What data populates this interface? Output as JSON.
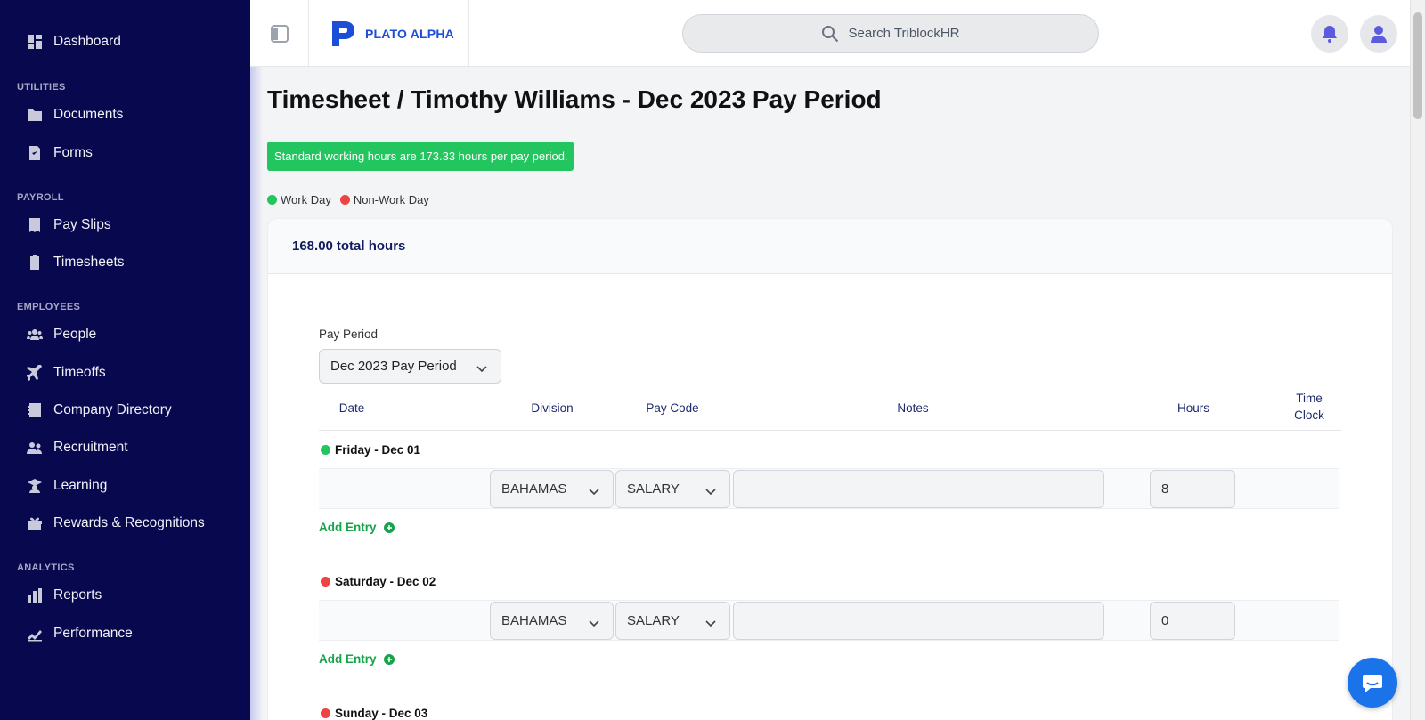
{
  "sidebar": {
    "dashboard": "Dashboard",
    "sections": {
      "utilities": "UTILITIES",
      "payroll": "PAYROLL",
      "employees": "EMPLOYEES",
      "analytics": "ANALYTICS"
    },
    "items": {
      "documents": "Documents",
      "forms": "Forms",
      "pay_slips": "Pay Slips",
      "timesheets": "Timesheets",
      "people": "People",
      "timeoffs": "Timeoffs",
      "company_directory": "Company Directory",
      "recruitment": "Recruitment",
      "learning": "Learning",
      "rewards": "Rewards & Recognitions",
      "reports": "Reports",
      "performance": "Performance"
    }
  },
  "header": {
    "logo_text": "PLATO ALPHA",
    "search_placeholder": "Search TriblockHR"
  },
  "page": {
    "title": "Timesheet / Timothy Williams - Dec 2023 Pay Period",
    "banner": "Standard working hours are 173.33 hours per pay period.",
    "legend": {
      "work_day": "Work Day",
      "non_work_day": "Non-Work Day"
    },
    "total_hours_value": "168.00",
    "total_hours_label": "total hours",
    "pay_period_label": "Pay Period",
    "pay_period_value": "Dec 2023 Pay Period"
  },
  "table": {
    "columns": {
      "date": "Date",
      "division": "Division",
      "pay_code": "Pay Code",
      "notes": "Notes",
      "hours": "Hours",
      "time_clock_1": "Time",
      "time_clock_2": "Clock"
    },
    "days": [
      {
        "label": "Friday - Dec 01",
        "type": "work",
        "division": "BAHAMAS",
        "pay_code": "SALARY",
        "notes": "",
        "hours": "8"
      },
      {
        "label": "Saturday - Dec 02",
        "type": "non-work",
        "division": "BAHAMAS",
        "pay_code": "SALARY",
        "notes": "",
        "hours": "0"
      },
      {
        "label": "Sunday - Dec 03",
        "type": "non-work"
      }
    ],
    "add_entry": "Add Entry"
  },
  "colors": {
    "sidebar_bg": "#08084f",
    "work_day": "#22c55e",
    "non_work_day": "#ef4444",
    "accent": "#16a34a"
  }
}
